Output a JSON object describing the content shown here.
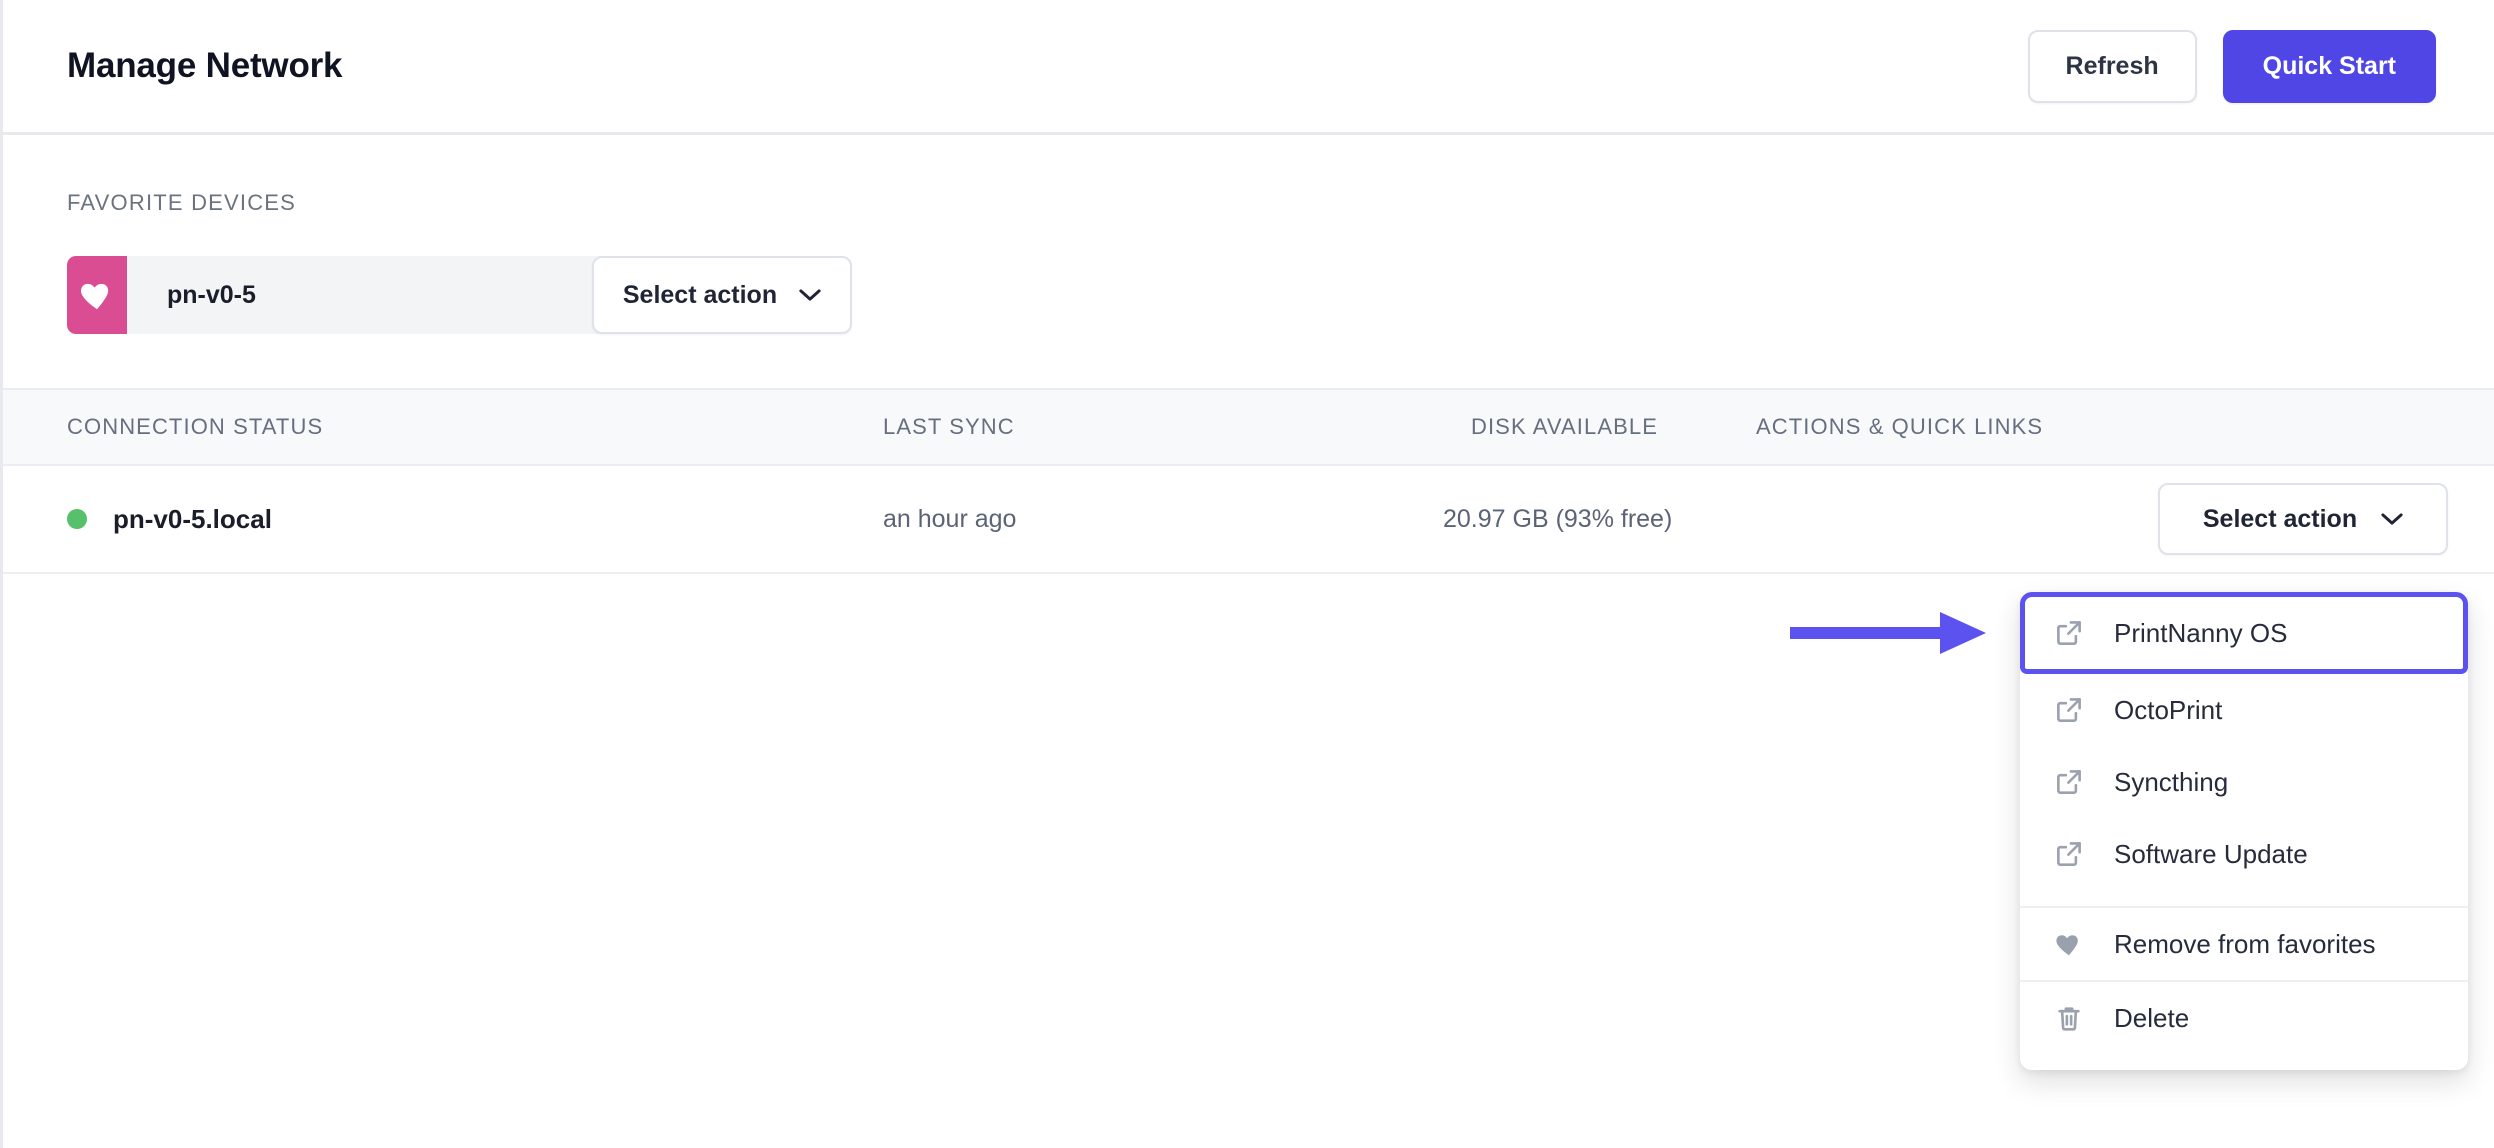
{
  "header": {
    "title": "Manage Network",
    "refresh_label": "Refresh",
    "quick_start_label": "Quick Start"
  },
  "favorites": {
    "section_label": "FAVORITE DEVICES",
    "device_name": "pn-v0-5",
    "select_action_label": "Select action",
    "heart_icon": "heart-icon",
    "heart_background_color": "#DB4D92",
    "chevron_icon": "chevron-down-icon"
  },
  "table": {
    "columns": [
      "CONNECTION STATUS",
      "LAST SYNC",
      "DISK AVAILABLE",
      "ACTIONS & QUICK LINKS"
    ],
    "rows": [
      {
        "status_icon": "status-dot-online",
        "status_color": "#56C06A",
        "hostname": "pn-v0-5.local",
        "last_sync": "an hour ago",
        "disk_available": "20.97 GB (93% free)",
        "action_label": "Select action"
      }
    ]
  },
  "dropdown": {
    "items": [
      {
        "label": "PrintNanny OS",
        "icon": "external-link-icon",
        "highlighted": true
      },
      {
        "label": "OctoPrint",
        "icon": "external-link-icon",
        "highlighted": false
      },
      {
        "label": "Syncthing",
        "icon": "external-link-icon",
        "highlighted": false
      },
      {
        "label": "Software Update",
        "icon": "external-link-icon",
        "highlighted": false
      },
      {
        "label": "Remove from favorites",
        "icon": "heart-icon",
        "highlighted": false
      },
      {
        "label": "Delete",
        "icon": "trash-icon",
        "highlighted": false
      }
    ]
  },
  "annotation": {
    "arrow_icon": "arrow-right-annotation",
    "arrow_color": "#5B52F0",
    "highlight_color": "#5B52F0"
  }
}
